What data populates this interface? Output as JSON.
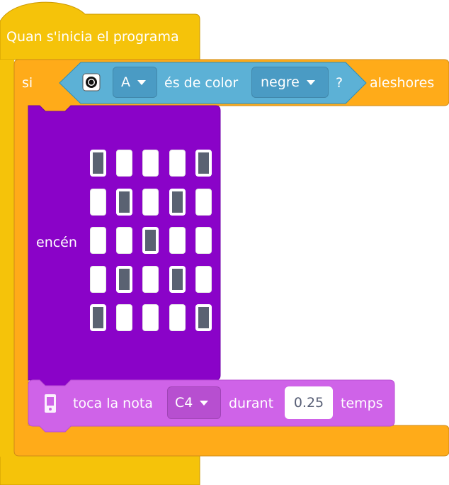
{
  "colors": {
    "event": "#f5c30a",
    "control": "#ffab19",
    "sensor": "#5cb1d6",
    "display": "#8a03c8",
    "music": "#cf63e8",
    "led_on": "#5a6272",
    "led_off": "#ffffff"
  },
  "hat": {
    "label": "Quan s'inicia el programa"
  },
  "if_block": {
    "label_if": "si",
    "label_then": "aleshores",
    "condition": {
      "sensor_icon": "light-sensor-icon",
      "port": "A",
      "label": "és de color",
      "color": "negre",
      "question": "?"
    }
  },
  "display_block": {
    "label": "encén",
    "matrix": [
      [
        1,
        0,
        0,
        0,
        1
      ],
      [
        0,
        1,
        0,
        1,
        0
      ],
      [
        0,
        0,
        1,
        0,
        0
      ],
      [
        0,
        1,
        0,
        1,
        0
      ],
      [
        1,
        0,
        0,
        0,
        1
      ]
    ]
  },
  "note_block": {
    "icon": "microbit-icon",
    "label_play": "toca la nota",
    "note": "C4",
    "label_for": "durant",
    "beats": "0.25",
    "label_beats": "temps"
  }
}
